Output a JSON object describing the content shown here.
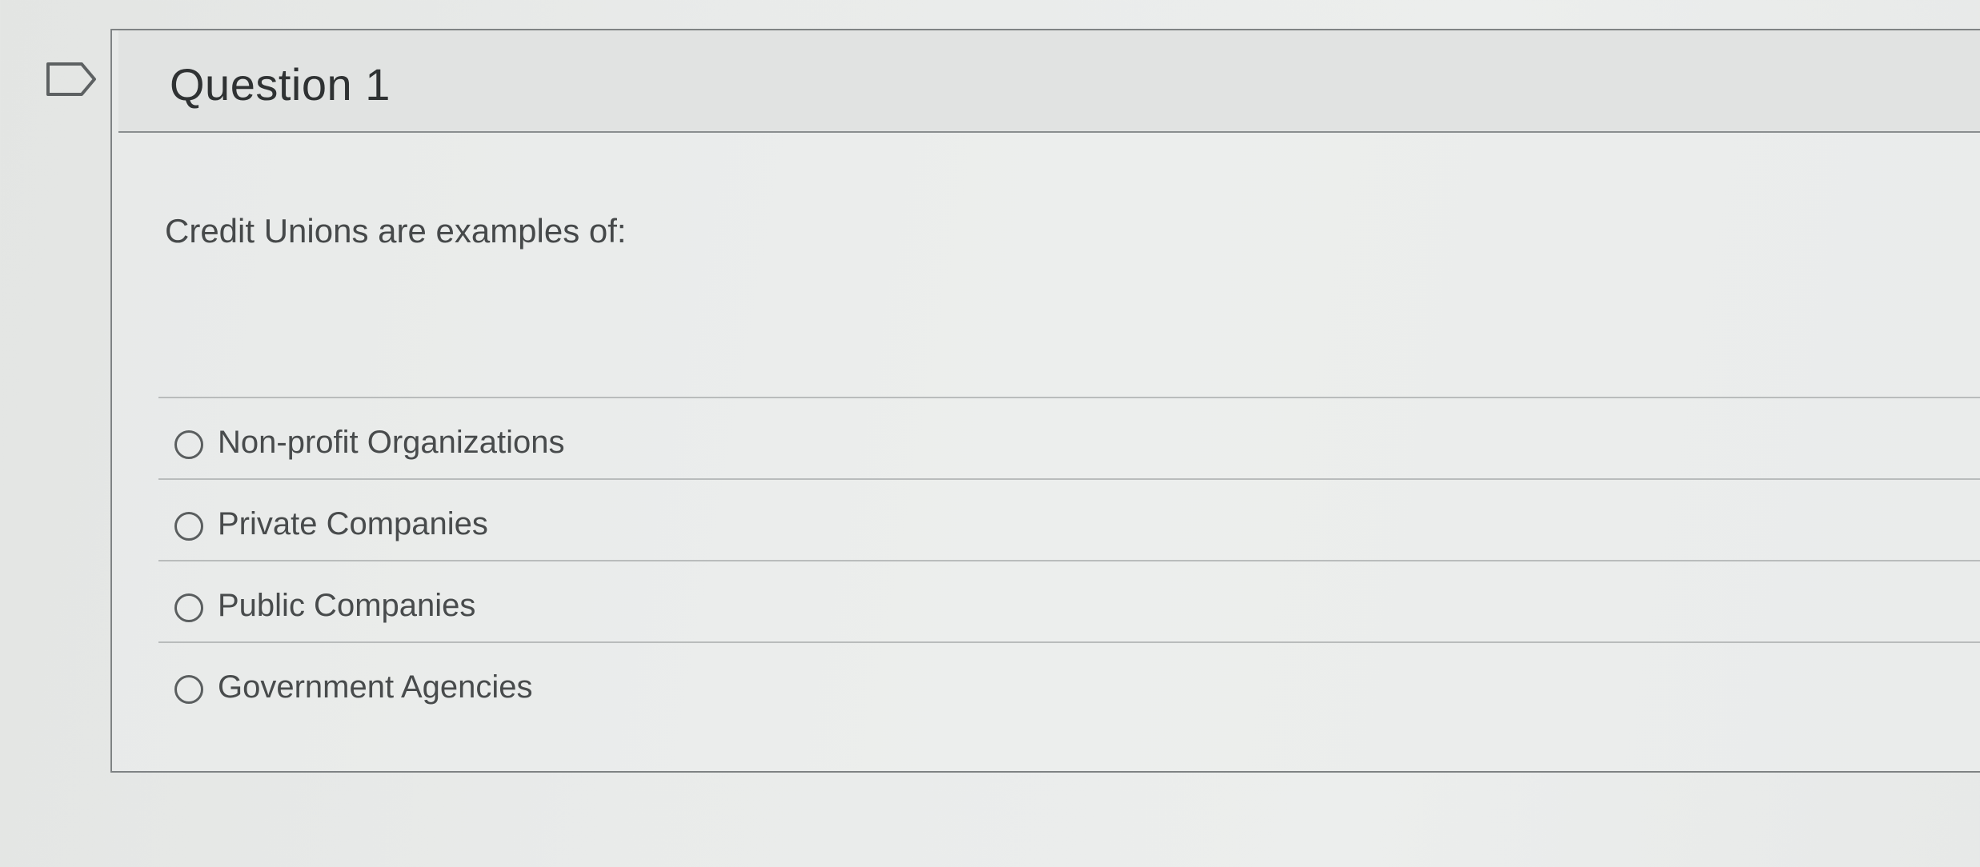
{
  "question": {
    "flag_icon": "flag-outline-icon",
    "title": "Question 1",
    "prompt": "Credit Unions are examples of:"
  },
  "answers": [
    {
      "label": "Non-profit Organizations",
      "selected": false
    },
    {
      "label": "Private Companies",
      "selected": false
    },
    {
      "label": "Public Companies",
      "selected": false
    },
    {
      "label": "Government Agencies",
      "selected": false
    }
  ],
  "colors": {
    "background": "#e8eae9",
    "header_background": "#e1e3e2",
    "border": "#7f8384",
    "text": "#46494a"
  }
}
